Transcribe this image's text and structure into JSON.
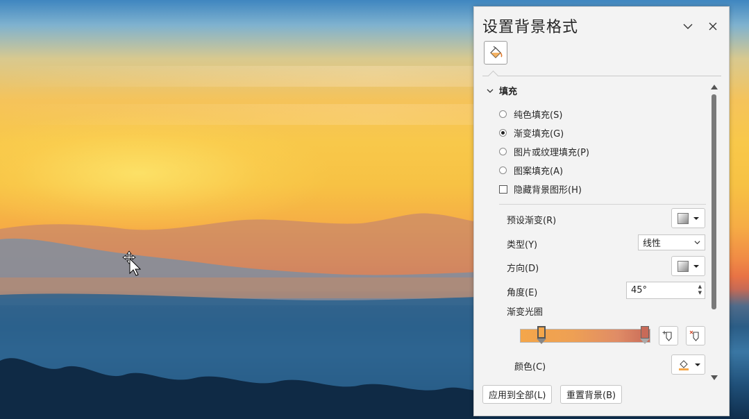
{
  "pane": {
    "title": "设置背景格式",
    "collapse_icon": "chevron-down-icon",
    "close_icon": "close-icon",
    "category_icon": "paint-bucket-icon"
  },
  "fill": {
    "section_label": "填充",
    "options": [
      {
        "label": "纯色填充(S)",
        "selected": false
      },
      {
        "label": "渐变填充(G)",
        "selected": true
      },
      {
        "label": "图片或纹理填充(P)",
        "selected": false
      },
      {
        "label": "图案填充(A)",
        "selected": false
      }
    ],
    "hide_bg_graphics": {
      "label": "隐藏背景图形(H)",
      "checked": false
    },
    "preset_gradient_label": "预设渐变(R)",
    "type_label": "类型(Y)",
    "type_value": "线性",
    "direction_label": "方向(D)",
    "angle_label": "角度(E)",
    "angle_value": "45°",
    "gradient_stops_label": "渐变光圈",
    "color_label": "颜色(C)",
    "gradient_colors": [
      "#f4a64a",
      "#c86a58"
    ]
  },
  "footer": {
    "apply_all_label": "应用到全部(L)",
    "reset_label": "重置背景(B)"
  },
  "colors": {
    "accent_orange": "#f0a040",
    "pane_bg": "#f3f3f3"
  }
}
